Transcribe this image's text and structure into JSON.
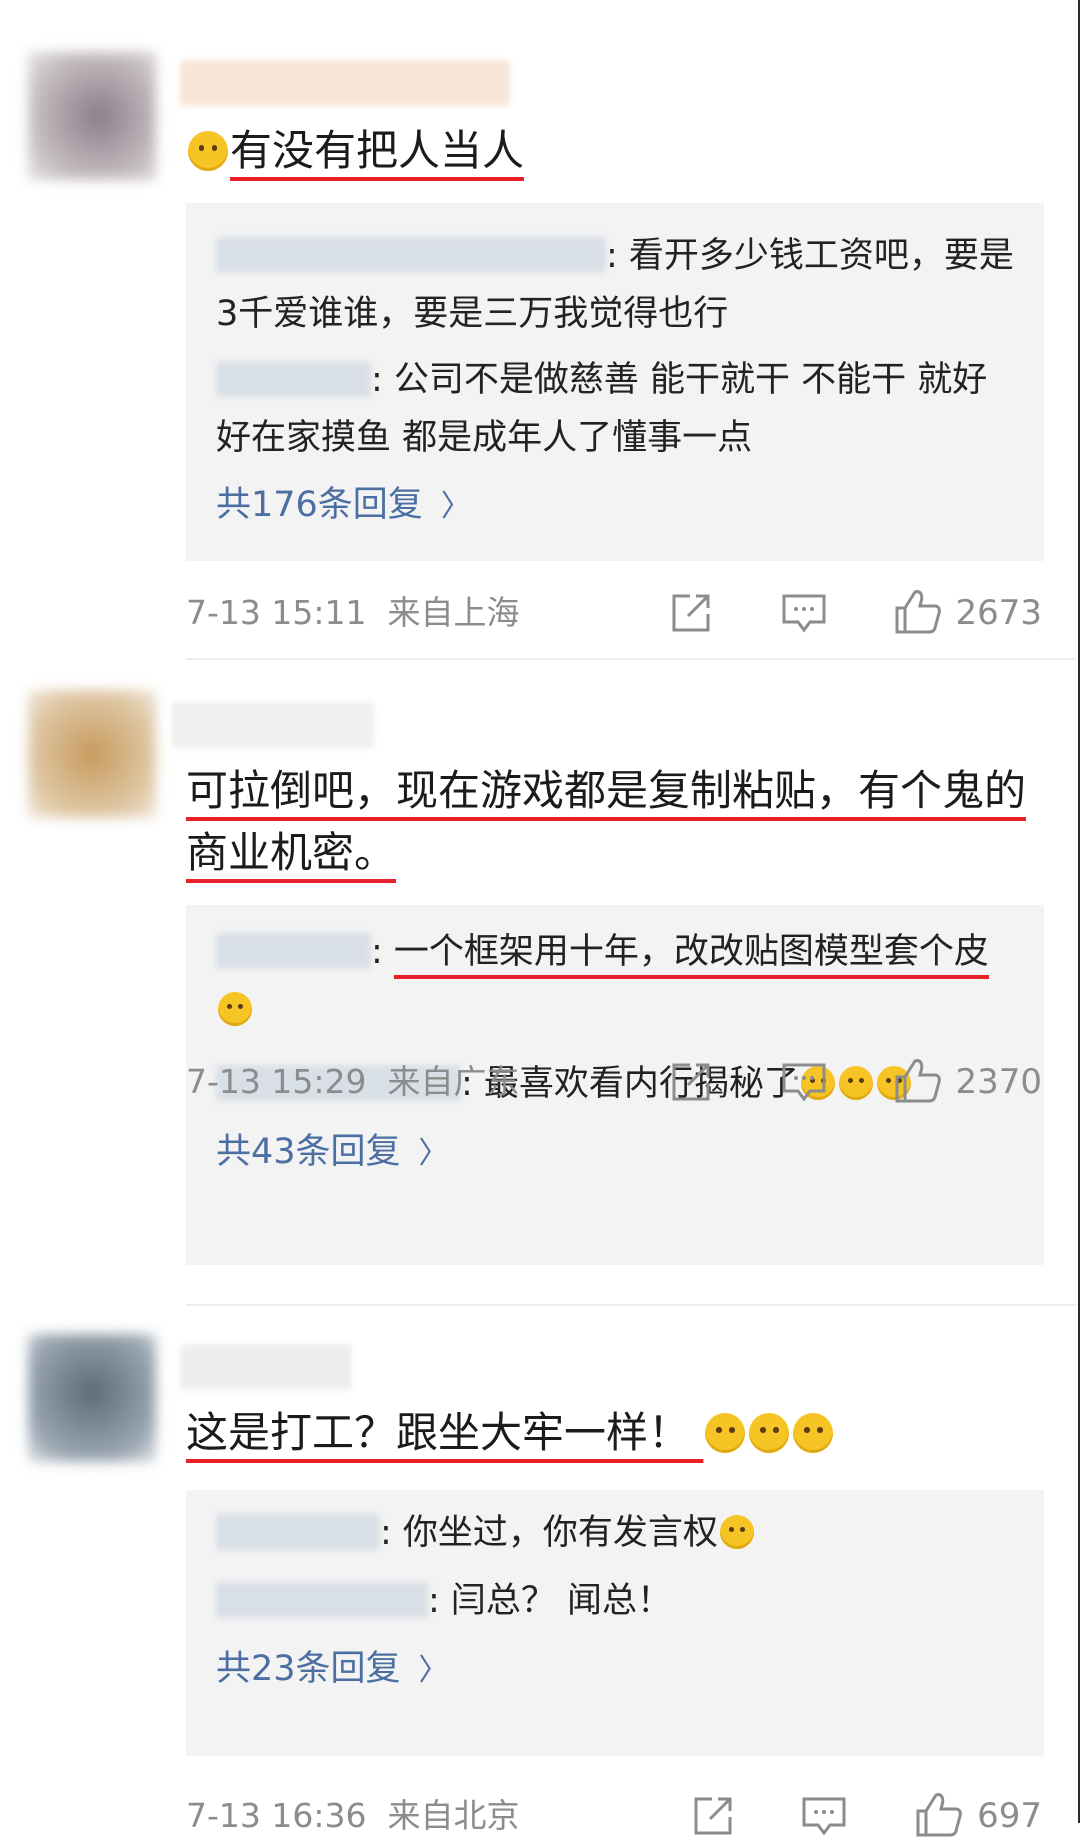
{
  "comments": [
    {
      "text": "有没有把人当人",
      "replies": [
        {
          "text": ": 看开多少钱工资吧，要是3千爱谁谁，要是三万我觉得也行"
        },
        {
          "text": ": 公司不是做慈善 能干就干 不能干 就好好在家摸鱼 都是成年人了懂事一点"
        }
      ],
      "more_label": "共176条回复",
      "time": "7-13 15:11",
      "location": "来自上海",
      "likes": "2673"
    },
    {
      "text": "可拉倒吧，现在游戏都是复制粘贴，有个鬼的商业机密。",
      "replies": [
        {
          "text_part1": ": ",
          "text_part2": "一个框架用十年，改改贴图模型套个皮"
        },
        {
          "text": ": 最喜欢看内行揭秘了"
        }
      ],
      "more_label": "共43条回复",
      "time": "7-13 15:29",
      "location": "来自广东",
      "likes": "2370"
    },
    {
      "text": "这是打工？跟坐大牢一样！",
      "replies": [
        {
          "text": ": 你坐过，你有发言权"
        },
        {
          "text": ": 闫总？ 闻总！"
        }
      ],
      "more_label": "共23条回复",
      "time": "7-13 16:36",
      "location": "来自北京",
      "likes": "697"
    }
  ],
  "colors": {
    "underline": "#e8202a",
    "link": "#4c6fa3",
    "meta": "#8c8c8c",
    "reply_bg": "#f3f3f3"
  },
  "icons": [
    "share-icon",
    "comment-icon",
    "like-icon",
    "chevron-right-icon",
    "emoji-sweat-smile-icon",
    "emoji-smile-icon",
    "emoji-cry-laugh-icon",
    "emoji-think-icon"
  ]
}
